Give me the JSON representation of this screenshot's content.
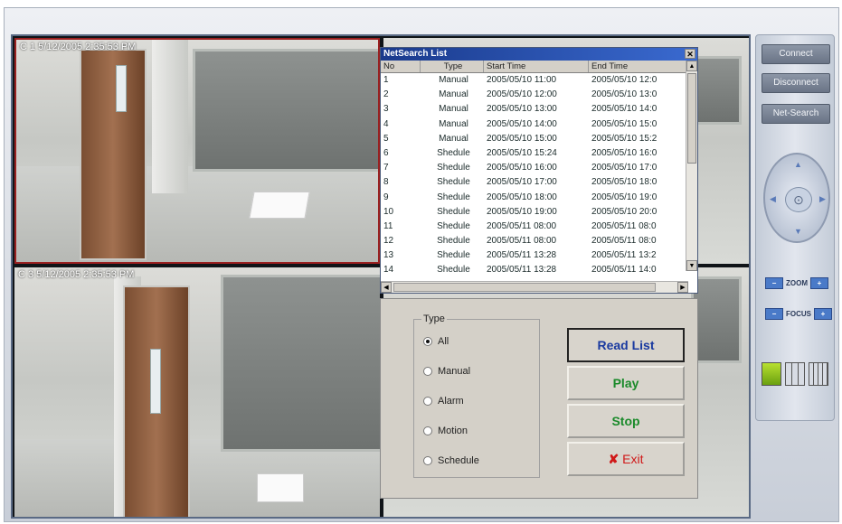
{
  "cameras": [
    {
      "label": "C 1  5/12/2005 2:35:53 PM"
    },
    {
      "label": "C 3  5/12/2005 2:35:53 PM"
    }
  ],
  "netsearch": {
    "title": "NetSearch List",
    "close_glyph": "✕",
    "columns": [
      "No",
      "Type",
      "Start Time",
      "End Time"
    ],
    "rows": [
      {
        "no": "1",
        "type": "Manual",
        "start": "2005/05/10 11:00",
        "end": "2005/05/10 12:0"
      },
      {
        "no": "2",
        "type": "Manual",
        "start": "2005/05/10 12:00",
        "end": "2005/05/10 13:0"
      },
      {
        "no": "3",
        "type": "Manual",
        "start": "2005/05/10 13:00",
        "end": "2005/05/10 14:0"
      },
      {
        "no": "4",
        "type": "Manual",
        "start": "2005/05/10 14:00",
        "end": "2005/05/10 15:0"
      },
      {
        "no": "5",
        "type": "Manual",
        "start": "2005/05/10 15:00",
        "end": "2005/05/10 15:2"
      },
      {
        "no": "6",
        "type": "Shedule",
        "start": "2005/05/10 15:24",
        "end": "2005/05/10 16:0"
      },
      {
        "no": "7",
        "type": "Shedule",
        "start": "2005/05/10 16:00",
        "end": "2005/05/10 17:0"
      },
      {
        "no": "8",
        "type": "Shedule",
        "start": "2005/05/10 17:00",
        "end": "2005/05/10 18:0"
      },
      {
        "no": "9",
        "type": "Shedule",
        "start": "2005/05/10 18:00",
        "end": "2005/05/10 19:0"
      },
      {
        "no": "10",
        "type": "Shedule",
        "start": "2005/05/10 19:00",
        "end": "2005/05/10 20:0"
      },
      {
        "no": "11",
        "type": "Shedule",
        "start": "2005/05/11 08:00",
        "end": "2005/05/11 08:0"
      },
      {
        "no": "12",
        "type": "Shedule",
        "start": "2005/05/11 08:00",
        "end": "2005/05/11 08:0"
      },
      {
        "no": "13",
        "type": "Shedule",
        "start": "2005/05/11 13:28",
        "end": "2005/05/11 13:2"
      },
      {
        "no": "14",
        "type": "Shedule",
        "start": "2005/05/11 13:28",
        "end": "2005/05/11 14:0"
      }
    ]
  },
  "filter": {
    "legend": "Type",
    "options": [
      {
        "label": "All",
        "checked": true
      },
      {
        "label": "Manual",
        "checked": false
      },
      {
        "label": "Alarm",
        "checked": false
      },
      {
        "label": "Motion",
        "checked": false
      },
      {
        "label": "Schedule",
        "checked": false
      }
    ]
  },
  "actions": {
    "read_list": "Read List",
    "play": "Play",
    "stop": "Stop",
    "exit": "Exit",
    "exit_icon": "✘"
  },
  "side": {
    "connect": "Connect",
    "disconnect": "Disconnect",
    "net_search": "Net-Search",
    "zoom": "ZOOM",
    "focus": "FOCUS"
  },
  "colors": {
    "read_list": "#1a3aa0",
    "play": "#1a8a2a",
    "stop": "#1a8a2a",
    "exit": "#d01818"
  }
}
